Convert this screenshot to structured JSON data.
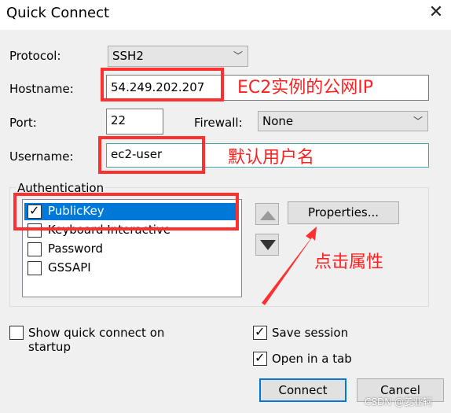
{
  "window": {
    "title": "Quick Connect",
    "close_glyph": "✕"
  },
  "protocol": {
    "label": "Protocol:",
    "value": "SSH2"
  },
  "hostname": {
    "label": "Hostname:",
    "value": "54.249.202.207",
    "annotation": "EC2实例的公网IP"
  },
  "port": {
    "label": "Port:",
    "value": "22"
  },
  "firewall": {
    "label": "Firewall:",
    "value": "None"
  },
  "username": {
    "label": "Username:",
    "value": "ec2-user",
    "annotation": "默认用户名"
  },
  "authentication": {
    "label": "Authentication",
    "methods": [
      {
        "label": "PublicKey",
        "checked": true,
        "selected": true
      },
      {
        "label": "Keyboard Interactive",
        "checked": false,
        "selected": false
      },
      {
        "label": "Password",
        "checked": false,
        "selected": false
      },
      {
        "label": "GSSAPI",
        "checked": false,
        "selected": false
      }
    ],
    "properties_button": "Properties...",
    "annotation": "点击属性"
  },
  "options": {
    "show_quick_connect": {
      "label": "Show quick connect on startup",
      "checked": false
    },
    "save_session": {
      "label": "Save session",
      "checked": true
    },
    "open_in_tab": {
      "label": "Open in a tab",
      "checked": true
    }
  },
  "buttons": {
    "connect": "Connect",
    "cancel": "Cancel"
  },
  "watermark": "CSDN @姜亚轲",
  "colors": {
    "annotation_red": "#ff3030",
    "selection_blue": "#0078d7",
    "accent_teal": "#3fa7a7"
  }
}
